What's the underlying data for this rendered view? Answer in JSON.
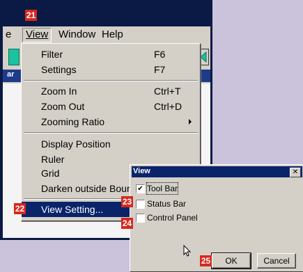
{
  "menubar": {
    "items": [
      {
        "label": "e"
      },
      {
        "label": "View"
      },
      {
        "label": "Window"
      },
      {
        "label": "Help"
      }
    ]
  },
  "sidebar_band_label": "ar",
  "view_menu": {
    "items": [
      {
        "label": "Filter",
        "shortcut": "F6"
      },
      {
        "label": "Settings",
        "shortcut": "F7"
      },
      {
        "label": "Zoom In",
        "shortcut": "Ctrl+T"
      },
      {
        "label": "Zoom Out",
        "shortcut": "Ctrl+D"
      },
      {
        "label": "Zooming Ratio",
        "shortcut": ""
      },
      {
        "label": "Display Position",
        "shortcut": ""
      },
      {
        "label": "Ruler",
        "shortcut": ""
      },
      {
        "label": "Grid",
        "shortcut": ""
      },
      {
        "label": "Darken outside Boun",
        "shortcut": ""
      },
      {
        "label": "View Setting...",
        "shortcut": ""
      }
    ]
  },
  "badges": {
    "b21": "21",
    "b22": "22",
    "b23": "23",
    "b24": "24",
    "b25": "25"
  },
  "view_dialog": {
    "title": "View",
    "close_glyph": "✕",
    "options": [
      {
        "label": "Tool Bar",
        "checked": true
      },
      {
        "label": "Status Bar",
        "checked": false
      },
      {
        "label": "Control Panel",
        "checked": false
      }
    ],
    "ok_label": "OK",
    "cancel_label": "Cancel"
  },
  "colors": {
    "badge": "#d7281e",
    "menu_highlight": "#0a246a",
    "background": "#cbc3dc"
  },
  "icons": {
    "check": "check-icon",
    "cursor": "mouse-pointer-icon",
    "submenu": "submenu-arrow-icon"
  }
}
